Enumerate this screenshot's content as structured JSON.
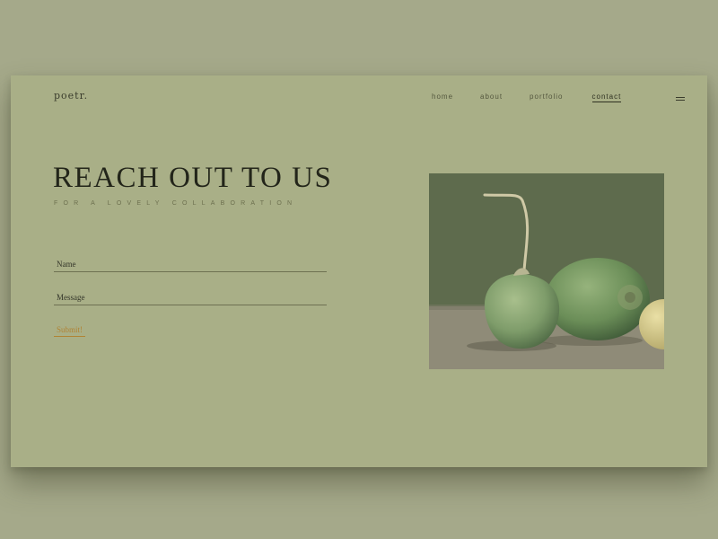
{
  "brand": {
    "logo": "poetr."
  },
  "nav": {
    "items": [
      {
        "label": "home"
      },
      {
        "label": "about"
      },
      {
        "label": "portfolio"
      },
      {
        "label": "contact",
        "active": true
      }
    ],
    "menu_icon": "hamburger-menu-icon"
  },
  "hero": {
    "title": "REACH OUT TO US",
    "subtitle": "FOR A LOVELY COLLABORATION"
  },
  "form": {
    "name_placeholder": "Name",
    "name_value": "",
    "message_placeholder": "Message",
    "message_value": "",
    "submit_label": "Submit!"
  },
  "image": {
    "subject": "radishes"
  },
  "colors": {
    "background": "#a5a98a",
    "card": "#a9af87",
    "text_dark": "#23251a",
    "accent": "#b08435"
  }
}
